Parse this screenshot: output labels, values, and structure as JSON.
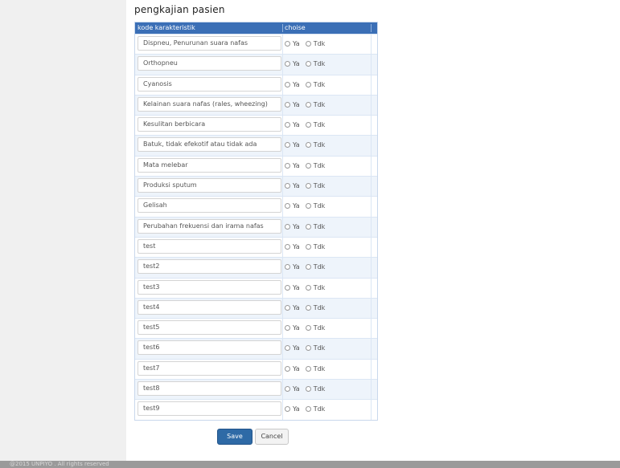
{
  "page_title": "pengkajian pasien",
  "table": {
    "headers": {
      "code": "kode karakteristik",
      "choise": "choise"
    },
    "rows": [
      {
        "label": "Dispneu, Penurunan suara nafas"
      },
      {
        "label": "Orthopneu"
      },
      {
        "label": "Cyanosis"
      },
      {
        "label": "Kelainan suara nafas (rales, wheezing)"
      },
      {
        "label": "Kesulitan berbicara"
      },
      {
        "label": "Batuk, tidak efekotif atau tidak ada"
      },
      {
        "label": "Mata melebar"
      },
      {
        "label": "Produksi sputum"
      },
      {
        "label": "Gelisah"
      },
      {
        "label": "Perubahan frekuensi dan irama nafas"
      },
      {
        "label": "test"
      },
      {
        "label": "test2"
      },
      {
        "label": "test3"
      },
      {
        "label": "test4"
      },
      {
        "label": "test5"
      },
      {
        "label": "test6"
      },
      {
        "label": "test7"
      },
      {
        "label": "test8"
      },
      {
        "label": "test9"
      }
    ],
    "option_yes": "Ya",
    "option_no": "Tdk"
  },
  "buttons": {
    "save": "Save",
    "cancel": "Cancel"
  },
  "footer_text": "@2015 UNPIYO . All rights reserved",
  "colors": {
    "header_bg": "#3b6fb6",
    "save_button": "#2e6aa6",
    "alt_row": "#eef4fb"
  }
}
